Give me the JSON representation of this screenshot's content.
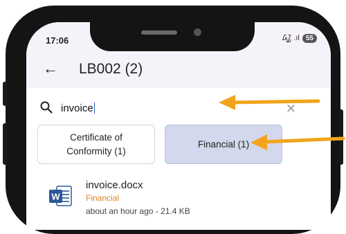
{
  "colors": {
    "accent": "#f2a41c",
    "category": "#e0822a",
    "selected_chip_bg": "#d3d8ec",
    "header_bg": "#f6f2f9"
  },
  "status_bar": {
    "time": "17:06",
    "battery": "55",
    "signal_glyphs": "ᮼ .ıl"
  },
  "app_bar": {
    "back_icon": "arrow-left-icon",
    "title": "LB002 (2)"
  },
  "search": {
    "query": "invoice",
    "icon": "search-icon",
    "clear_icon": "close-icon",
    "clear_glyph": "✕"
  },
  "filters": [
    {
      "label_line1": "Certificate of",
      "label_line2": "Conformity (1)",
      "selected": false
    },
    {
      "label": "Financial (1)",
      "selected": true
    }
  ],
  "files": [
    {
      "name": "invoice.docx",
      "category": "Financial",
      "meta": "about an hour ago - 21.4 KB",
      "icon": "word-document-icon"
    }
  ],
  "annotations": {
    "arrow_count": 2,
    "arrow_icon": "orange-arrow-icon"
  }
}
